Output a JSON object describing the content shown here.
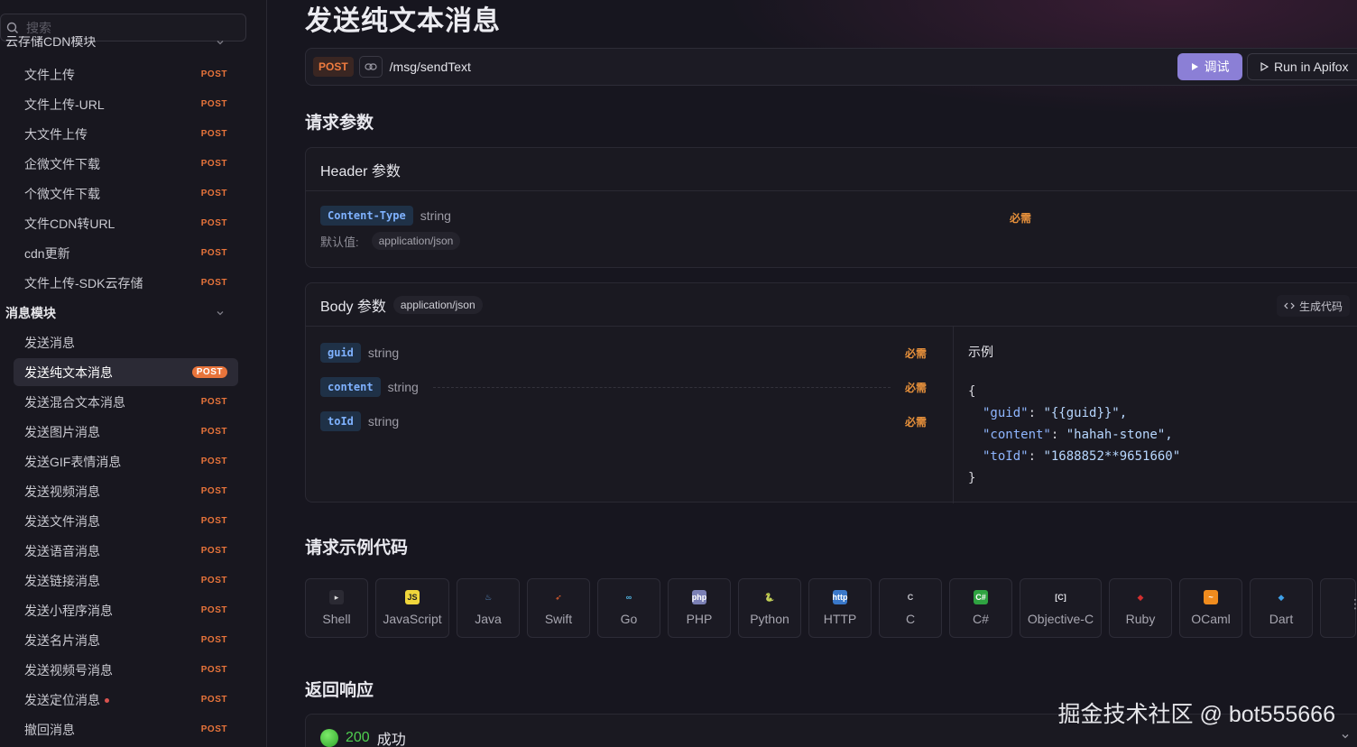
{
  "search": {
    "placeholder": "搜索"
  },
  "sidebar": {
    "group_cdn": "云存储CDN模块",
    "cdn_items": [
      {
        "label": "文件上传",
        "method": "POST"
      },
      {
        "label": "文件上传-URL",
        "method": "POST"
      },
      {
        "label": "大文件上传",
        "method": "POST"
      },
      {
        "label": "企微文件下载",
        "method": "POST"
      },
      {
        "label": "个微文件下载",
        "method": "POST"
      },
      {
        "label": "文件CDN转URL",
        "method": "POST"
      },
      {
        "label": "cdn更新",
        "method": "POST"
      },
      {
        "label": "文件上传-SDK云存储",
        "method": "POST"
      }
    ],
    "group_msg": "消息模块",
    "msg_items": [
      {
        "label": "发送消息",
        "method": ""
      },
      {
        "label": "发送纯文本消息",
        "method": "POST"
      },
      {
        "label": "发送混合文本消息",
        "method": "POST"
      },
      {
        "label": "发送图片消息",
        "method": "POST"
      },
      {
        "label": "发送GIF表情消息",
        "method": "POST"
      },
      {
        "label": "发送视频消息",
        "method": "POST"
      },
      {
        "label": "发送文件消息",
        "method": "POST"
      },
      {
        "label": "发送语音消息",
        "method": "POST"
      },
      {
        "label": "发送链接消息",
        "method": "POST"
      },
      {
        "label": "发送小程序消息",
        "method": "POST"
      },
      {
        "label": "发送名片消息",
        "method": "POST"
      },
      {
        "label": "发送视频号消息",
        "method": "POST"
      },
      {
        "label": "发送定位消息",
        "method": "POST"
      },
      {
        "label": "撤回消息",
        "method": "POST"
      }
    ]
  },
  "page": {
    "title": "发送纯文本消息"
  },
  "endpoint": {
    "method": "POST",
    "path": "/msg/sendText",
    "debug_label": "调试",
    "apifox_label": "Run in Apifox"
  },
  "params": {
    "section_title": "请求参数",
    "header_title": "Header 参数",
    "header_field": {
      "name": "Content-Type",
      "type": "string",
      "required": "必需",
      "default_label": "默认值:",
      "default_value": "application/json"
    },
    "body_title": "Body 参数",
    "body_content_type": "application/json",
    "gen_code_label": "生成代码",
    "body_fields": [
      {
        "name": "guid",
        "type": "string",
        "required": "必需"
      },
      {
        "name": "content",
        "type": "string",
        "required": "必需"
      },
      {
        "name": "toId",
        "type": "string",
        "required": "必需"
      }
    ],
    "example_title": "示例",
    "example_lines": {
      "open": "{",
      "l1_key": "\"guid\"",
      "l1_val": "\"{{guid}}\",",
      "l2_key": "\"content\"",
      "l2_val": "\"hahah-stone\",",
      "l3_key": "\"toId\"",
      "l3_val": "\"1688852**9651660\"",
      "close": "}"
    }
  },
  "code_section": {
    "title": "请求示例代码",
    "tabs": [
      "Shell",
      "JavaScript",
      "Java",
      "Swift",
      "Go",
      "PHP",
      "Python",
      "HTTP",
      "C",
      "C#",
      "Objective-C",
      "Ruby",
      "OCaml",
      "Dart"
    ]
  },
  "response": {
    "title": "返回响应",
    "code": "200",
    "status": "成功"
  },
  "watermark": "掘金技术社区 @ bot555666",
  "colors": {
    "accent": "#8b7fd6",
    "method_post": "#e8743b",
    "required": "#e8913b",
    "success": "#3fbf3f"
  }
}
